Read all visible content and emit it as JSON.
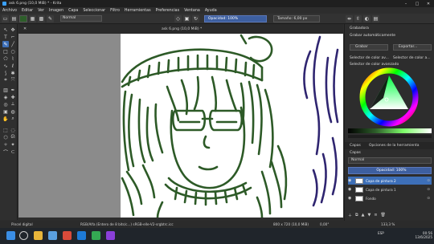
{
  "window": {
    "title": "ask 6.png (10,0 MiB) * - Krita",
    "min": "–",
    "max": "□",
    "close": "✕"
  },
  "menu": [
    "Archivo",
    "Editar",
    "Ver",
    "Imagen",
    "Capa",
    "Seleccionar",
    "Filtro",
    "Herramientas",
    "Preferencias",
    "Ventana",
    "Ayuda"
  ],
  "toolbar": {
    "blend_mode": "Normal",
    "opacity": "Opacidad: 100%",
    "size": "Tamaño: 6,00 px",
    "fg_color": "#2d5e2a",
    "bg_color": "#f2f2f2"
  },
  "document": {
    "tab": "ask 6.png (10,0 MiB) *",
    "line_color": "#2d5a27",
    "hair_color": "#2f2570"
  },
  "docker": {
    "recorder_title": "Grabadora",
    "recorder_option": "Grabar automáticamente",
    "record_label": "Grabar",
    "export_label": "Exportar...",
    "selector_tab1": "Selector de color av...",
    "selector_tab2": "Selector de color a...",
    "advanced_title": "Selector de color avanzado",
    "layers_tab": "Capas",
    "brush_tab": "Opciones de la herramienta",
    "layers_title": "Capas",
    "layers_blend": "Normal",
    "layers_opacity": "Opacidad: 100%",
    "layers": [
      {
        "name": "Capa de pintura 2",
        "selected": true
      },
      {
        "name": "Capa de pintura 1",
        "selected": false
      },
      {
        "name": "Fondo",
        "selected": false
      }
    ]
  },
  "status": {
    "brush": "Pincel digital",
    "colorspace": "RGB/Alfa (Entero de 8 bits/c...)  sRGB-elle-V2-srgbtrc.icc",
    "dims": "800 x 720 (10,0 MiB)",
    "angle": "0,00°",
    "zoom": "133,3 %"
  },
  "taskbar": {
    "time": "00:56",
    "date": "13/6/2025",
    "lang": "ESP"
  }
}
